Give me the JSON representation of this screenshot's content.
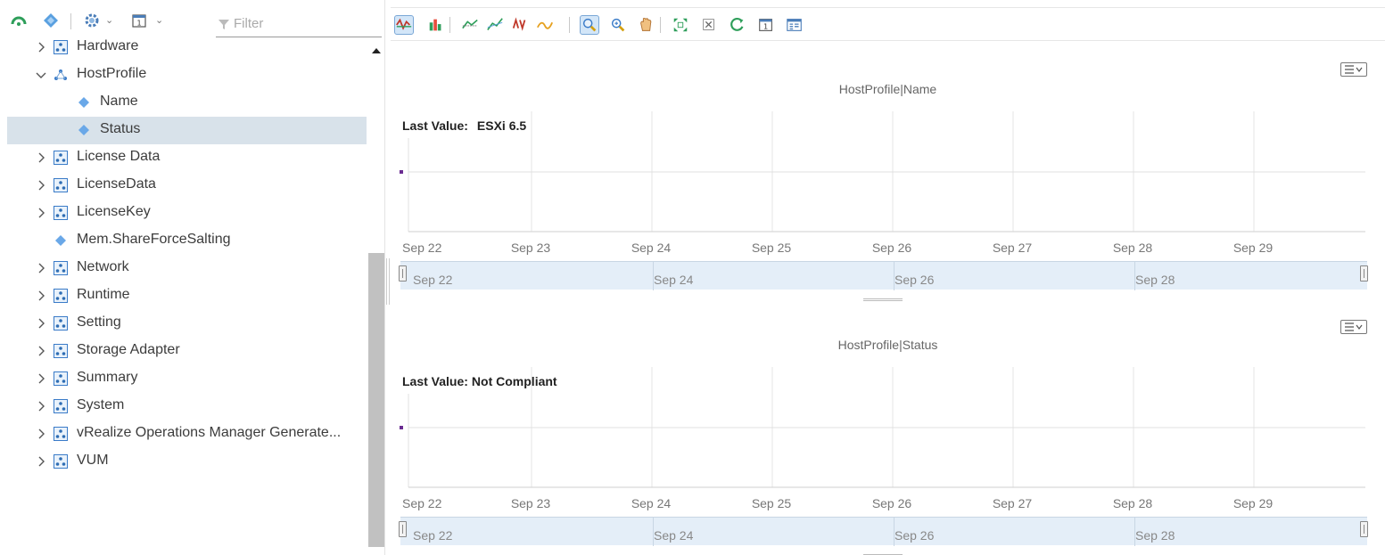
{
  "left_toolbar": {
    "filter_placeholder": "Filter"
  },
  "tree": [
    {
      "label": "Hardware",
      "expanded": false,
      "type": "group",
      "level": 0
    },
    {
      "label": "HostProfile",
      "expanded": true,
      "type": "group",
      "level": 0
    },
    {
      "label": "Name",
      "type": "metric",
      "level": 1
    },
    {
      "label": "Status",
      "type": "metric",
      "level": 1,
      "selected": true
    },
    {
      "label": "License Data",
      "expanded": false,
      "type": "group",
      "level": 0
    },
    {
      "label": "LicenseData",
      "expanded": false,
      "type": "group",
      "level": 0
    },
    {
      "label": "LicenseKey",
      "expanded": false,
      "type": "group",
      "level": 0
    },
    {
      "label": "Mem.ShareForceSalting",
      "type": "metric",
      "level": 0
    },
    {
      "label": "Network",
      "expanded": false,
      "type": "group",
      "level": 0
    },
    {
      "label": "Runtime",
      "expanded": false,
      "type": "group",
      "level": 0
    },
    {
      "label": "Setting",
      "expanded": false,
      "type": "group",
      "level": 0
    },
    {
      "label": "Storage Adapter",
      "expanded": false,
      "type": "group",
      "level": 0
    },
    {
      "label": "Summary",
      "expanded": false,
      "type": "group",
      "level": 0
    },
    {
      "label": "System",
      "expanded": false,
      "type": "group",
      "level": 0
    },
    {
      "label": "vRealize Operations Manager Generate...",
      "expanded": false,
      "type": "group",
      "level": 0
    },
    {
      "label": "VUM",
      "expanded": false,
      "type": "group",
      "level": 0
    }
  ],
  "right_toolbar": {
    "icons": [
      "stacked-charts-icon",
      "bar-chart-icon",
      "trend-line-icon",
      "dynamic-threshold-icon",
      "show-outliers-icon",
      "show-chart-values-icon",
      "zoom-to-fit-icon",
      "zoom-view-icon",
      "pan-icon",
      "fit-all-icon",
      "remove-all-icon",
      "refresh-icon",
      "date-controls-icon",
      "generate-dashboard-icon"
    ]
  },
  "charts": [
    {
      "title": "HostProfile|Name",
      "last_value_label": "Last Value:",
      "last_value": "ESXi 6.5"
    },
    {
      "title": "HostProfile|Status",
      "last_value_label": "Last Value:",
      "last_value": "Not Compliant"
    }
  ],
  "chart_data": [
    {
      "type": "line",
      "title": "HostProfile|Name",
      "x_ticks": [
        "Sep 22",
        "Sep 23",
        "Sep 24",
        "Sep 25",
        "Sep 26",
        "Sep 27",
        "Sep 28",
        "Sep 29"
      ],
      "navigator_ticks": [
        "Sep 22",
        "Sep 24",
        "Sep 26",
        "Sep 28"
      ],
      "series": [
        {
          "values": [
            "ESXi 6.5"
          ],
          "x": [
            "Sep 22"
          ]
        }
      ],
      "marker_color": "#6a2c91",
      "grid": true
    },
    {
      "type": "line",
      "title": "HostProfile|Status",
      "x_ticks": [
        "Sep 22",
        "Sep 23",
        "Sep 24",
        "Sep 25",
        "Sep 26",
        "Sep 27",
        "Sep 28",
        "Sep 29"
      ],
      "navigator_ticks": [
        "Sep 22",
        "Sep 24",
        "Sep 26",
        "Sep 28"
      ],
      "series": [
        {
          "values": [
            "Not Compliant"
          ],
          "x": [
            "Sep 22"
          ]
        }
      ],
      "marker_color": "#6a2c91",
      "grid": true
    }
  ]
}
